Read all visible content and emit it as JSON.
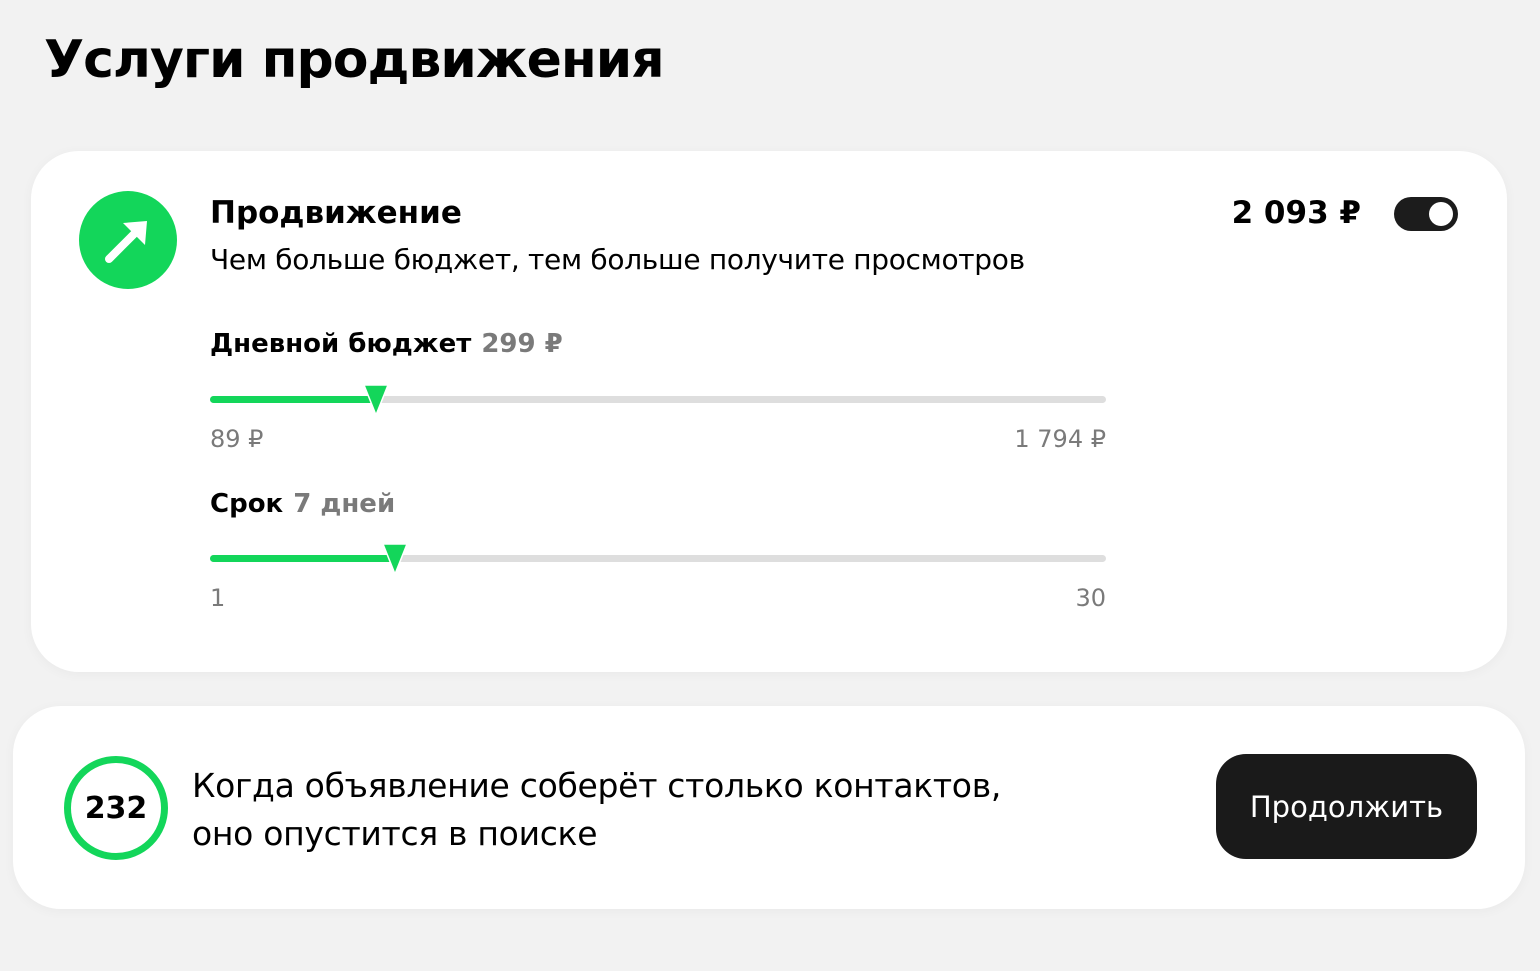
{
  "page": {
    "title": "Услуги продвижения"
  },
  "promotion": {
    "icon": "arrow-up-right-icon",
    "title": "Продвижение",
    "description": "Чем больше бюджет, тем больше получите просмотров",
    "price": "2 093 ₽",
    "toggle_on": true,
    "accent_color": "#13d65a"
  },
  "daily_budget": {
    "label": "Дневной бюджет",
    "value_text": "299 ₽",
    "value": 299,
    "min": 89,
    "max": 1794,
    "min_label": "89 ₽",
    "max_label": "1 794 ₽"
  },
  "duration": {
    "label": "Срок",
    "value_text": "7 дней",
    "value": 7,
    "min": 1,
    "max": 30,
    "min_label": "1",
    "max_label": "30"
  },
  "summary": {
    "contacts": "232",
    "text_line1": "Когда объявление соберёт столько контактов,",
    "text_line2": "оно опустится в поиске",
    "continue_label": "Продолжить"
  }
}
